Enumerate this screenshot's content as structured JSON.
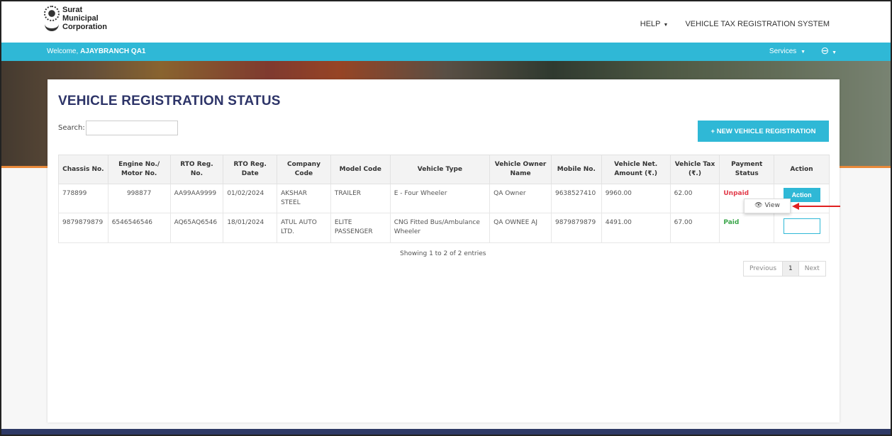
{
  "brand": {
    "line1": "Surat",
    "line2": "Municipal",
    "line3": "Corporation",
    "emblem_icon": "smc-emblem-icon"
  },
  "topnav": {
    "help": "HELP",
    "system": "VEHICLE TAX REGISTRATION SYSTEM"
  },
  "bluebar": {
    "welcome_prefix": "Welcome,",
    "user": "AJAYBRANCH QA1",
    "services": "Services"
  },
  "page": {
    "title": "VEHICLE REGISTRATION STATUS",
    "search_label": "Search:",
    "search_value": "",
    "new_button": "+ NEW VEHICLE REGISTRATION"
  },
  "table": {
    "headers": {
      "chassis": "Chassis No.",
      "engine1": "Engine No./",
      "engine2": "Motor No.",
      "rto1": "RTO Reg.",
      "rto2": "No.",
      "date1": "RTO Reg.",
      "date2": "Date",
      "company1": "Company",
      "company2": "Code",
      "model": "Model Code",
      "vtype": "Vehicle Type",
      "owner1": "Vehicle Owner",
      "owner2": "Name",
      "mobile": "Mobile No.",
      "amount1": "Vehicle Net.",
      "amount2": "Amount (₹.)",
      "tax1": "Vehicle Tax",
      "tax2": "(₹.)",
      "pay1": "Payment",
      "pay2": "Status",
      "action": "Action"
    },
    "rows": [
      {
        "chassis": "778899",
        "engine": "998877",
        "rto": "AA99AA9999",
        "date": "01/02/2024",
        "company1": "AKSHAR",
        "company2": "STEEL",
        "model1": "TRAILER",
        "model2": "",
        "vtype1": "E - Four Wheeler",
        "vtype2": "",
        "owner": "QA Owner",
        "mobile": "9638527410",
        "amount": "9960.00",
        "tax": "62.00",
        "status": "Unpaid",
        "action": "Action"
      },
      {
        "chassis": "9879879879",
        "engine": "6546546546",
        "rto": "AQ65AQ6546",
        "date": "18/01/2024",
        "company1": "ATUL AUTO",
        "company2": "LTD.",
        "model1": "ELITE",
        "model2": "PASSENGER",
        "vtype1": "CNG Fitted Bus/Ambulance",
        "vtype2": "Wheeler",
        "owner": "QA OWNEE AJ",
        "mobile": "9879879879",
        "amount": "4491.00",
        "tax": "67.00",
        "status": "Paid",
        "action": ""
      }
    ]
  },
  "dropdown": {
    "view": "View"
  },
  "footer": {
    "showing": "Showing 1 to 2 of 2 entries",
    "previous": "Previous",
    "page": "1",
    "next": "Next"
  },
  "colors": {
    "accent": "#2fb8d6",
    "title": "#2d3468",
    "unpaid": "#e23b4a",
    "paid": "#3aa64a",
    "arrow": "#e02020"
  }
}
